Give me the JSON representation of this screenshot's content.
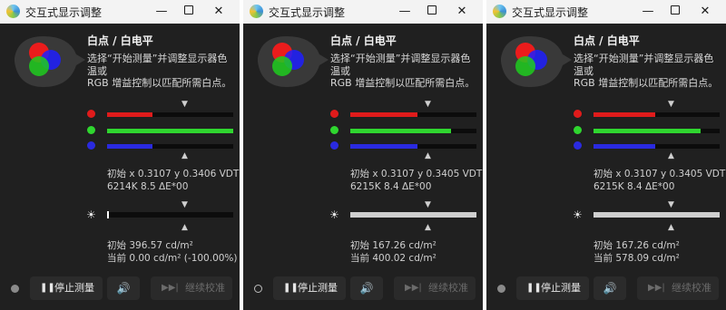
{
  "chart_data": [
    {
      "type": "bar",
      "title": "白点 / 白电平",
      "series": [
        {
          "name": "R",
          "color": "#e01b1b",
          "value": 0.36
        },
        {
          "name": "G",
          "color": "#2fd62f",
          "value": 1.0
        },
        {
          "name": "B",
          "color": "#2a2ae0",
          "value": 0.36
        }
      ],
      "brightness": {
        "value": 0.0,
        "color": "#ffffff"
      },
      "initial_label": "初始 x 0.3107 y 0.3406 VDT",
      "temp_label": "6214K 8.5 ΔE*00",
      "initial_luminance": "初始 396.57 cd/m²",
      "current_luminance": "当前 0.00 cd/m² (-100.00%)"
    },
    {
      "type": "bar",
      "title": "白点 / 白电平",
      "series": [
        {
          "name": "R",
          "color": "#e01b1b",
          "value": 0.53
        },
        {
          "name": "G",
          "color": "#2fd62f",
          "value": 0.8
        },
        {
          "name": "B",
          "color": "#2a2ae0",
          "value": 0.53
        }
      ],
      "brightness": {
        "value": 1.0,
        "color": "#cfcfcf"
      },
      "initial_label": "初始 x 0.3107 y 0.3405 VDT",
      "temp_label": "6215K 8.4 ΔE*00",
      "initial_luminance": "初始 167.26 cd/m²",
      "current_luminance": "当前 400.02 cd/m²"
    },
    {
      "type": "bar",
      "title": "白点 / 白电平",
      "series": [
        {
          "name": "R",
          "color": "#e01b1b",
          "value": 0.49
        },
        {
          "name": "G",
          "color": "#2fd62f",
          "value": 0.85
        },
        {
          "name": "B",
          "color": "#2a2ae0",
          "value": 0.49
        }
      ],
      "brightness": {
        "value": 1.0,
        "color": "#cfcfcf"
      },
      "initial_label": "初始 x 0.3107 y 0.3405 VDT",
      "temp_label": "6215K 8.4 ΔE*00",
      "initial_luminance": "初始 167.26 cd/m²",
      "current_luminance": "当前 578.09 cd/m²"
    }
  ],
  "windows": [
    {
      "title": "交互式显示调整",
      "heading": "白点 / 白电平",
      "desc": "选择“开始测量”并调整显示器色温或\nRGB 增益控制以匹配所需白点。",
      "status": "filled",
      "stop_label": "停止测量",
      "continue_label": "继续校准"
    },
    {
      "title": "交互式显示调整",
      "heading": "白点 / 白电平",
      "desc": "选择“开始测量”并调整显示器色温或\nRGB 增益控制以匹配所需白点。",
      "status": "ring",
      "stop_label": "停止测量",
      "continue_label": "继续校准"
    },
    {
      "title": "交互式显示调整",
      "heading": "白点 / 白电平",
      "desc": "选择“开始测量”并调整显示器色温或\nRGB 增益控制以匹配所需白点。",
      "status": "filled",
      "stop_label": "停止测量",
      "continue_label": "继续校准"
    }
  ],
  "icons": {
    "minimize": "—",
    "close": "✕",
    "stop": "❚❚",
    "sound": "🔊",
    "continue": "▶▶|",
    "sun": "☀",
    "marker_down": "▼",
    "marker_up": "▲"
  }
}
